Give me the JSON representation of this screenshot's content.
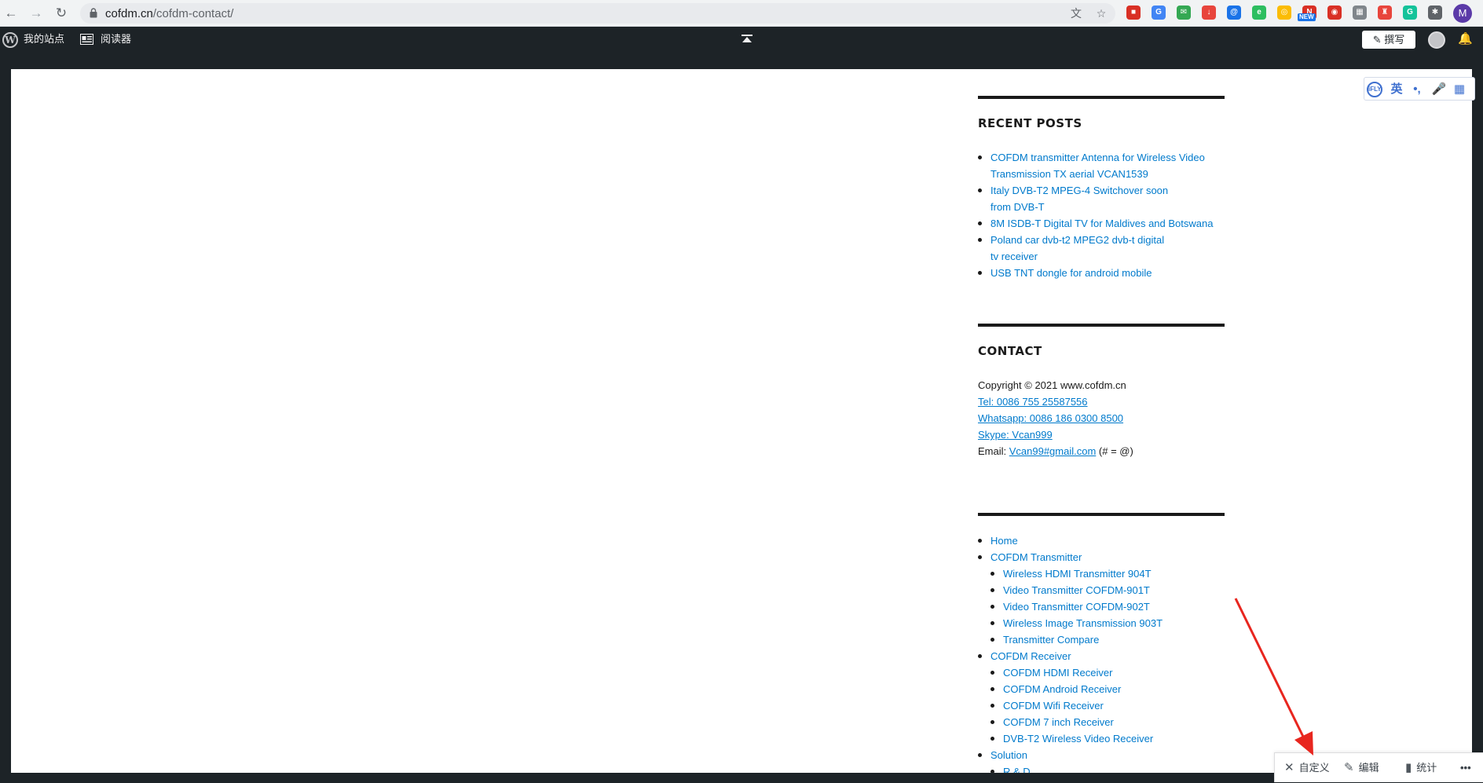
{
  "browser": {
    "url_host": "cofdm.cn",
    "url_path": "/cofdm-contact/",
    "avatar_letter": "M",
    "extensions": [
      {
        "name": "ext-red-icon",
        "color": "#d93025",
        "glyph": "■"
      },
      {
        "name": "google-translate-icon",
        "color": "#4285f4",
        "glyph": "G"
      },
      {
        "name": "mail-ext-icon",
        "color": "#34a853",
        "glyph": "✉"
      },
      {
        "name": "download-ext-icon",
        "color": "#e8453c",
        "glyph": "↓"
      },
      {
        "name": "at-ext-icon",
        "color": "#1a73e8",
        "glyph": "@"
      },
      {
        "name": "evernote-icon",
        "color": "#2dbe60",
        "glyph": "e"
      },
      {
        "name": "chrome-ext-icon",
        "color": "#fbbc04",
        "glyph": "◎"
      },
      {
        "name": "new-badge-ext-icon",
        "color": "#d93025",
        "glyph": "N"
      },
      {
        "name": "target-ext-icon",
        "color": "#d93025",
        "glyph": "◉"
      },
      {
        "name": "grid-ext-icon",
        "color": "#80868b",
        "glyph": "▦"
      },
      {
        "name": "bag-ext-icon",
        "color": "#e8453c",
        "glyph": "♜"
      },
      {
        "name": "grammarly-icon",
        "color": "#15c39a",
        "glyph": "G"
      },
      {
        "name": "puzzle-icon",
        "color": "#5f6368",
        "glyph": "✱"
      }
    ],
    "new_badge": "NEW"
  },
  "wp_bar": {
    "site_label": "我的站点",
    "reader_label": "阅读器",
    "write_label": "撰写"
  },
  "recent_posts": {
    "title": "RECENT POSTS",
    "items": [
      "COFDM transmitter Antenna for Wireless Video Transmission TX aerial VCAN1539",
      "Italy DVB-T2 MPEG-4 Switchover soon from DVB-T",
      "8M ISDB-T Digital TV for Maldives and Botswana",
      "Poland car dvb-t2 MPEG2 dvb-t digital tv receiver",
      "USB TNT dongle for android mobile"
    ]
  },
  "contact": {
    "title": "CONTACT",
    "copyright": "Copyright © 2021 www.cofdm.cn",
    "tel": "Tel: 0086 755 25587556",
    "whatsapp": "Whatsapp: 0086 186 0300 8500",
    "skype": "Skype: Vcan999",
    "email_label": "Email: ",
    "email": "Vcan99#gmail.com",
    "email_note": " (# = @)"
  },
  "menu": {
    "home": "Home",
    "transmitter": "COFDM Transmitter",
    "transmitter_sub": [
      "Wireless HDMI Transmitter 904T",
      "Video Transmitter COFDM-901T",
      "Video Transmitter COFDM-902T",
      "Wireless Image Transmission 903T",
      "Transmitter Compare"
    ],
    "receiver": "COFDM Receiver",
    "receiver_sub": [
      "COFDM HDMI Receiver",
      "COFDM Android Receiver",
      "COFDM Wifi Receiver",
      "COFDM 7 inch Receiver",
      "DVB-T2 Wireless Video Receiver"
    ],
    "solution": "Solution",
    "rd": "R & D"
  },
  "iflytek": {
    "logo": "iFLY",
    "english": "英"
  },
  "admin_float": {
    "customize": "自定义",
    "edit": "编辑",
    "stats": "统计",
    "more": "•••"
  },
  "colors": {
    "link": "#007acc",
    "admin_bar": "#1d2327",
    "annotation_arrow": "#e8261f"
  }
}
